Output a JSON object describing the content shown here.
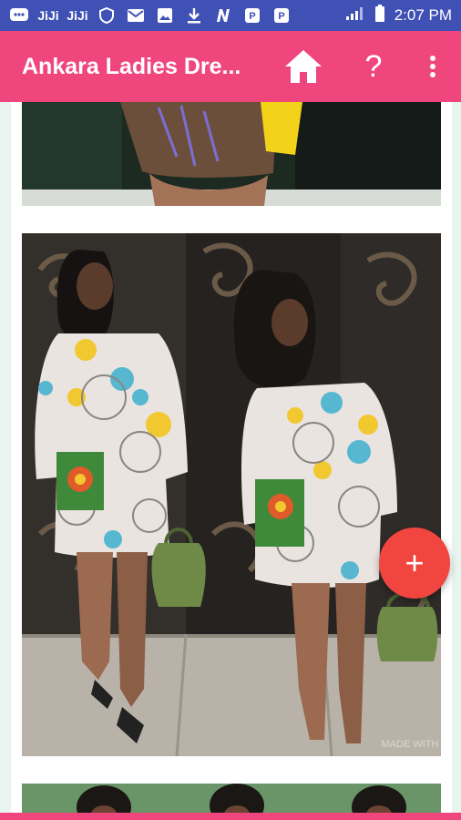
{
  "status": {
    "time": "2:07 PM",
    "icons": [
      "message-icon",
      "jiji-icon",
      "jiji-icon",
      "vpn-icon",
      "mail-icon",
      "image-icon",
      "download-icon",
      "n-icon",
      "pdf-icon",
      "pdf-icon"
    ],
    "notif_text_1": "JiJi",
    "notif_text_2": "JiJi"
  },
  "toolbar": {
    "title": "Ankara Ladies Dre...",
    "help_label": "?",
    "color": "#f0467e"
  },
  "cards": {
    "watermark": "MADE WITH"
  },
  "fab": {
    "label": "+",
    "color": "#f0463f"
  }
}
